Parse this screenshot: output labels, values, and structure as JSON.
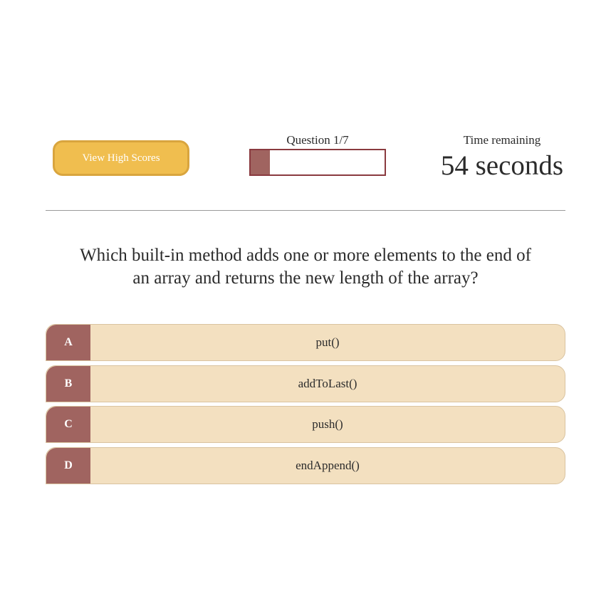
{
  "header": {
    "high_scores_label": "View High Scores",
    "question_counter": "Question 1/7",
    "progress": {
      "current": 1,
      "total": 7
    },
    "timer_label": "Time remaining",
    "timer_value": "54 seconds"
  },
  "question": {
    "text": "Which built-in method adds one or more elements to the end of an array and returns the new length of the array?"
  },
  "answers": [
    {
      "letter": "A",
      "text": "put()"
    },
    {
      "letter": "B",
      "text": "addToLast()"
    },
    {
      "letter": "C",
      "text": "push()"
    },
    {
      "letter": "D",
      "text": "endAppend()"
    }
  ],
  "colors": {
    "accent_button": "#f0be4f",
    "progress_fill": "#a06460",
    "progress_border": "#8a3a3f",
    "answer_bg": "#f3e0c0",
    "letter_bg": "#a06460"
  }
}
